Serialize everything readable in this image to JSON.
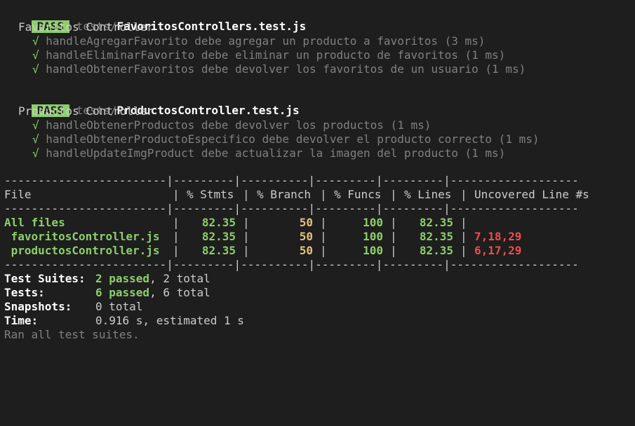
{
  "suites": [
    {
      "status": "PASS",
      "dir": "tests/",
      "file": "FavoritosControllers.test.js",
      "describe": "Favoritos Controller",
      "tests": [
        "handleAgregarFavorito debe agregar un producto a favoritos (3 ms)",
        "handleEliminarFavorito debe eliminar un producto de favoritos (1 ms)",
        "handleObtenerFavoritos debe devolver los favoritos de un usuario (1 ms)"
      ]
    },
    {
      "status": "PASS",
      "dir": "tests/",
      "file": "ProductosController.test.js",
      "describe": "Productos Controller",
      "tests": [
        "handleObtenerProductos debe devolver los productos (1 ms)",
        "handleObtenerProductoEspecifico debe devolver el producto correcto (1 ms)",
        "handleUpdateImgProduct debe actualizar la imagen del producto (1 ms)"
      ]
    }
  ],
  "check_glyph": "√",
  "coverage": {
    "border_top": "------------------------|---------|----------|---------|---------|-------------------",
    "border_mid": "------------------------|---------|----------|---------|---------|-------------------",
    "border_bot": "------------------------|---------|----------|---------|---------|-------------------",
    "headers": [
      "File",
      "% Stmts",
      "% Branch",
      "% Funcs",
      "% Lines",
      "Uncovered Line #s"
    ],
    "rows": [
      {
        "file": "All files",
        "stmts": "82.35",
        "branch": "50",
        "funcs": "100",
        "lines": "82.35",
        "uncovered": ""
      },
      {
        "file": " favoritosController.js",
        "stmts": "82.35",
        "branch": "50",
        "funcs": "100",
        "lines": "82.35",
        "uncovered": "7,18,29"
      },
      {
        "file": " productosController.js",
        "stmts": "82.35",
        "branch": "50",
        "funcs": "100",
        "lines": "82.35",
        "uncovered": "6,17,29"
      }
    ]
  },
  "summary": {
    "suites_label": "Test Suites:",
    "suites_passed": "2 passed",
    "suites_rest": ", 2 total",
    "tests_label": "Tests:",
    "tests_passed": "6 passed",
    "tests_rest": ", 6 total",
    "snapshots_label": "Snapshots:",
    "snapshots_value": "0 total",
    "time_label": "Time:",
    "time_value": "0.916 s, estimated 1 s",
    "footer": "Ran all test suites."
  },
  "colors": {
    "background": "#1e1e1e",
    "pass_green": "#8ccf6a",
    "branch_yellow": "#e5c07b",
    "uncovered_red": "#f14c4c"
  }
}
